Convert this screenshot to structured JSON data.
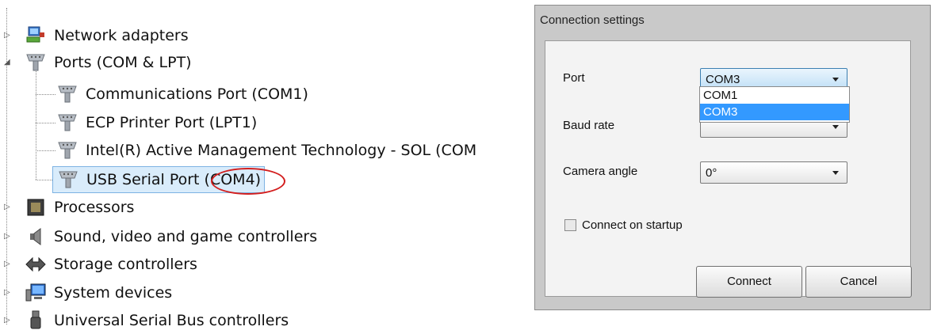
{
  "device_tree": {
    "items": [
      {
        "label": "Network adapters",
        "icon": "network-adapter-icon",
        "expander": "collapsed"
      },
      {
        "label": "Ports (COM & LPT)",
        "icon": "port-icon",
        "expander": "expanded"
      },
      {
        "label": "Communications Port (COM1)",
        "icon": "port-icon"
      },
      {
        "label": "ECP Printer Port (LPT1)",
        "icon": "port-icon"
      },
      {
        "label": "Intel(R) Active Management Technology - SOL (COM",
        "icon": "port-icon"
      },
      {
        "label": "USB Serial Port (COM4)",
        "icon": "port-icon",
        "selected": true
      },
      {
        "label": "Processors",
        "icon": "processor-icon",
        "expander": "collapsed"
      },
      {
        "label": "Sound, video and game controllers",
        "icon": "speaker-icon",
        "expander": "collapsed"
      },
      {
        "label": "Storage controllers",
        "icon": "storage-icon",
        "expander": "collapsed"
      },
      {
        "label": "System devices",
        "icon": "computer-icon",
        "expander": "collapsed"
      },
      {
        "label": "Universal Serial Bus controllers",
        "icon": "usb-icon",
        "expander": "collapsed"
      }
    ]
  },
  "dialog": {
    "title": "Connection settings",
    "port_label": "Port",
    "port_value": "COM3",
    "port_options": [
      "COM1",
      "COM3"
    ],
    "port_highlighted": "COM3",
    "baud_label": "Baud rate",
    "camera_label": "Camera angle",
    "camera_value": "0°",
    "startup_label": "Connect on startup",
    "startup_checked": false,
    "connect_label": "Connect",
    "cancel_label": "Cancel"
  },
  "colors": {
    "highlight": "#3399ff",
    "annotation": "#d31e1e",
    "selection": "#d9ecfb"
  }
}
